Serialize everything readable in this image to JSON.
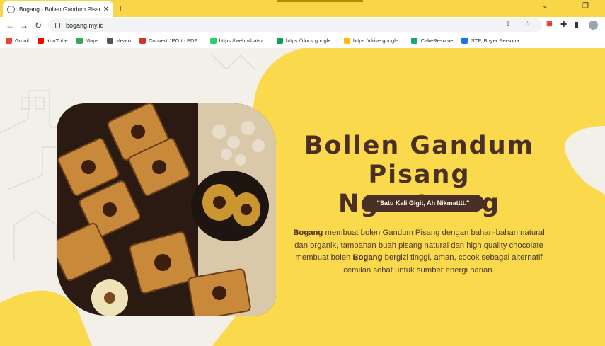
{
  "browser": {
    "tab_title": "Bogang - Bollen Gandum Pisang",
    "url": "bogang.my.id",
    "new_tab_icon": "plus-icon",
    "colors": {
      "tab_strip": "#f8d648",
      "brand_brown": "#4a2f25",
      "brand_yellow": "#fbd94c"
    }
  },
  "bookmarks": [
    {
      "label": "Gmail",
      "color": "#ea4335"
    },
    {
      "label": "YouTube",
      "color": "#ff0000"
    },
    {
      "label": "Maps",
      "color": "#34a853"
    },
    {
      "label": "vlearn",
      "color": "#555555"
    },
    {
      "label": "Convert JPG to PDF...",
      "color": "#d93025"
    },
    {
      "label": "https://web.whatsa...",
      "color": "#25d366"
    },
    {
      "label": "https://docs.google...",
      "color": "#0f9d58"
    },
    {
      "label": "https://drive.google...",
      "color": "#fbbc04"
    },
    {
      "label": "CakeResume",
      "color": "#19a974"
    },
    {
      "label": "STP, Buyer Persona...",
      "color": "#1a73e8"
    }
  ],
  "hero": {
    "headline_line1": "Bollen Gandum",
    "headline_line2": "Pisang Ngentrong",
    "tagline": "\"Satu Kali Gigit, Ah Nikmatttt.\"",
    "desc_brand": "Bogang",
    "desc_part1": " membuat bolen Gandum Pisang dengan bahan-bahan natural dan organik, tambahan buah pisang natural dan high quality chocolate membuat bolen ",
    "desc_brand2": "Bogang",
    "desc_part2": " bergizi tinggi, aman, cocok sebagai alternatif cemilan sehat untuk sumber energi harian."
  }
}
